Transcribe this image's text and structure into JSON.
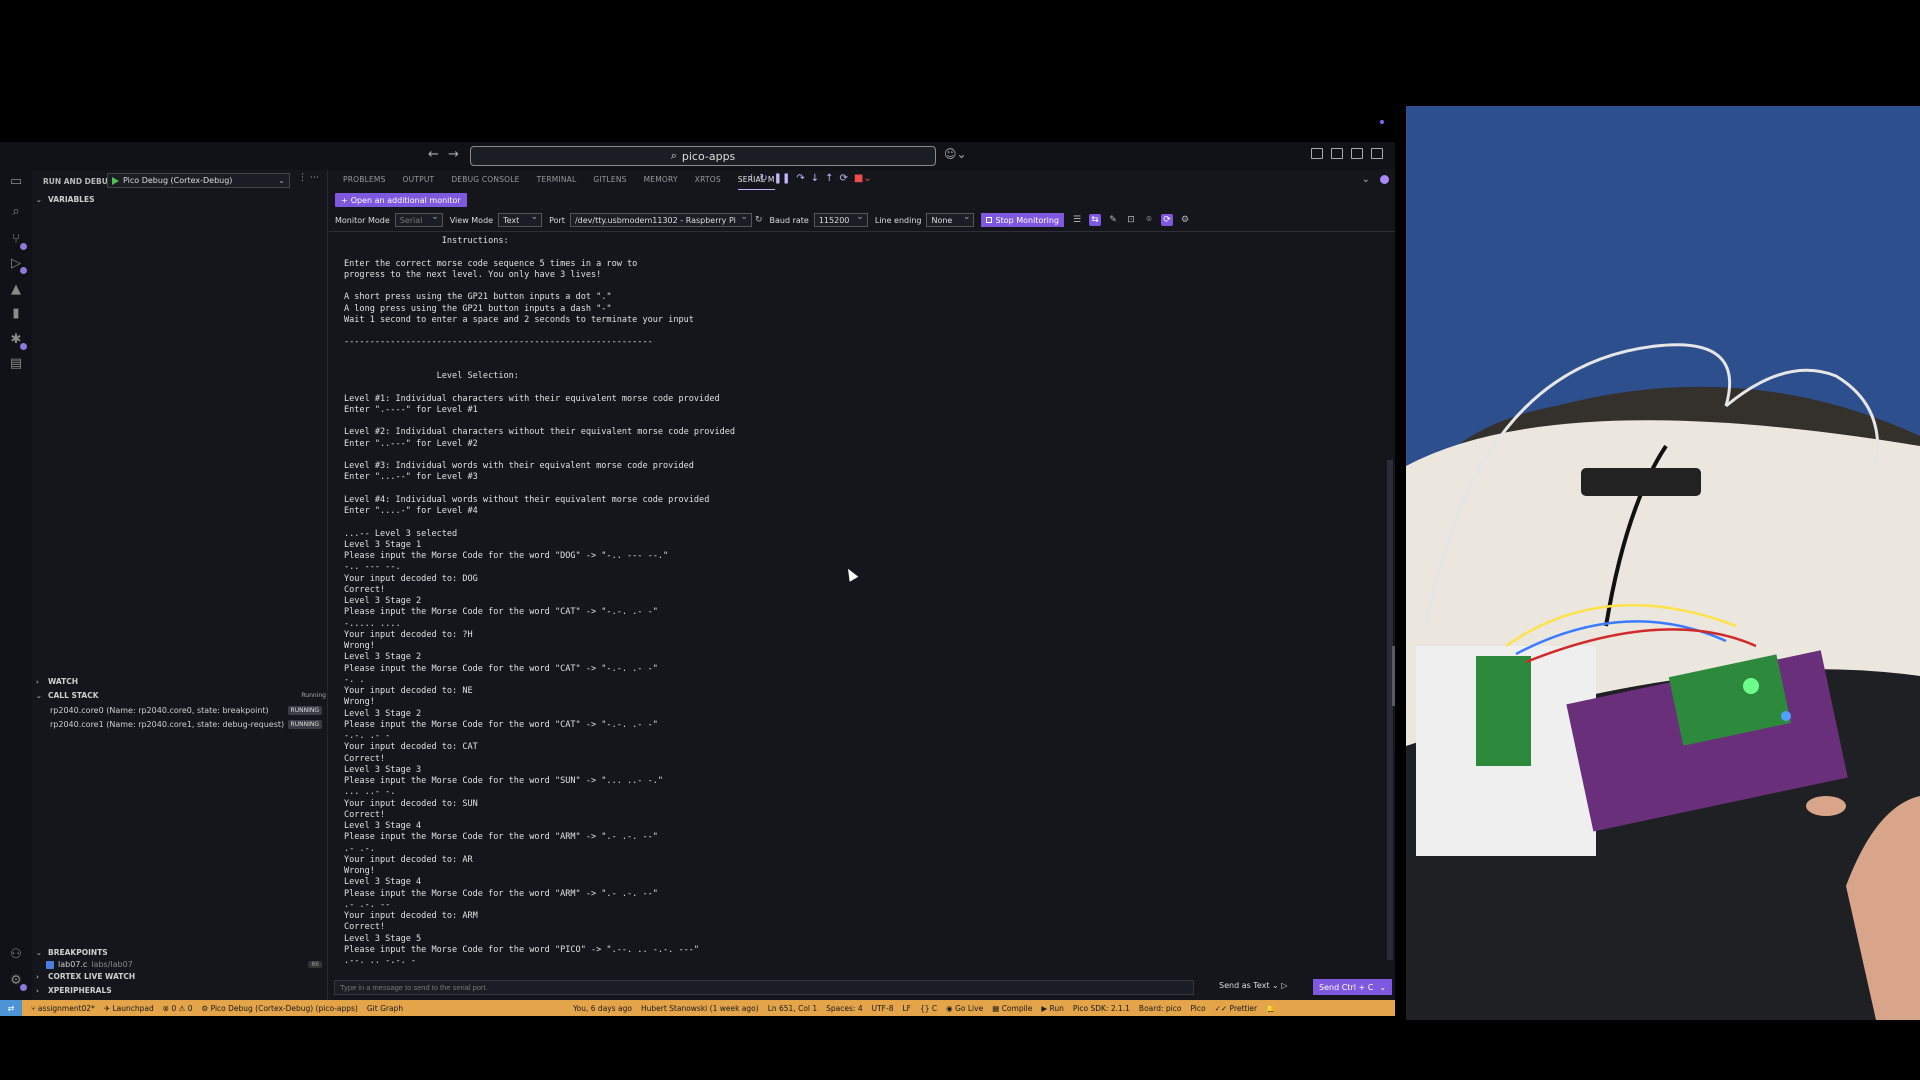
{
  "titlebar": {
    "search_text": "pico-apps",
    "copilot_icon": "copilot-icon"
  },
  "sidebar": {
    "run_label": "RUN AND DEBUG",
    "debug_config": "Pico Debug (Cortex-Debug)",
    "sections": {
      "variables": "VARIABLES",
      "watch": "WATCH",
      "call_stack": "CALL STACK",
      "call_stack_status": "Running",
      "breakpoints": "BREAKPOINTS",
      "cortex_live_watch": "CORTEX LIVE WATCH",
      "xperipherals": "XPERIPHERALS"
    },
    "call_stack_items": [
      {
        "name": "rp2040.core0 (Name: rp2040.core0, state: breakpoint)",
        "badge": "RUNNING"
      },
      {
        "name": "rp2040.core1 (Name: rp2040.core1, state: debug-request)",
        "badge": "RUNNING"
      }
    ],
    "breakpoint": {
      "file": "lab07.c",
      "path": "labs/lab07",
      "count": "86"
    }
  },
  "panel": {
    "tabs": [
      "PROBLEMS",
      "OUTPUT",
      "DEBUG CONSOLE",
      "TERMINAL",
      "GITLENS",
      "MEMORY",
      "XRTOS",
      "SERIAL M"
    ],
    "active_tab": "SERIAL M",
    "add_monitor_label": "Open an additional monitor",
    "monitor": {
      "monitor_mode_label": "Monitor Mode",
      "monitor_mode_value": "Serial",
      "view_mode_label": "View Mode",
      "view_mode_value": "Text",
      "port_label": "Port",
      "port_value": "/dev/tty.usbmodem11302 - Raspberry Pi",
      "baud_label": "Baud rate",
      "baud_value": "115200",
      "line_ending_label": "Line ending",
      "line_ending_value": "None",
      "stop_label": "Stop Monitoring"
    },
    "output_lines": [
      "                   Instructions:",
      "",
      "Enter the correct morse code sequence 5 times in a row to",
      "progress to the next level. You only have 3 lives!",
      "",
      "A short press using the GP21 button inputs a dot \".\"",
      "A long press using the GP21 button inputs a dash \"-\"",
      "Wait 1 second to enter a space and 2 seconds to terminate your input",
      "",
      "------------------------------------------------------------",
      "",
      "",
      "                  Level Selection:",
      "",
      "Level #1: Individual characters with their equivalent morse code provided",
      "Enter \".----\" for Level #1",
      "",
      "Level #2: Individual characters without their equivalent morse code provided",
      "Enter \"..---\" for Level #2",
      "",
      "Level #3: Individual words with their equivalent morse code provided",
      "Enter \"...--\" for Level #3",
      "",
      "Level #4: Individual words without their equivalent morse code provided",
      "Enter \"....-\" for Level #4",
      "",
      "...-- Level 3 selected",
      "Level 3 Stage 1",
      "Please input the Morse Code for the word \"DOG\" -> \"-.. --- --.\"",
      "-.. --- --.",
      "Your input decoded to: DOG",
      "Correct!",
      "Level 3 Stage 2",
      "Please input the Morse Code for the word \"CAT\" -> \"-.-. .- -\"",
      "-..... ....",
      "Your input decoded to: ?H",
      "Wrong!",
      "Level 3 Stage 2",
      "Please input the Morse Code for the word \"CAT\" -> \"-.-. .- -\"",
      "-. .",
      "Your input decoded to: NE",
      "Wrong!",
      "Level 3 Stage 2",
      "Please input the Morse Code for the word \"CAT\" -> \"-.-. .- -\"",
      "-.-. .- -",
      "Your input decoded to: CAT",
      "Correct!",
      "Level 3 Stage 3",
      "Please input the Morse Code for the word \"SUN\" -> \"... ..- -.\"",
      "... ..- -.",
      "Your input decoded to: SUN",
      "Correct!",
      "Level 3 Stage 4",
      "Please input the Morse Code for the word \"ARM\" -> \".- .-. --\"",
      ".- .-.",
      "Your input decoded to: AR",
      "Wrong!",
      "Level 3 Stage 4",
      "Please input the Morse Code for the word \"ARM\" -> \".- .-. --\"",
      ".- .-. --",
      "Your input decoded to: ARM",
      "Correct!",
      "Level 3 Stage 5",
      "Please input the Morse Code for the word \"PICO\" -> \".--. .. -.-. ---\"",
      ".--. .. -.-. -"
    ],
    "message_placeholder": "Type in a message to send to the serial port.",
    "send_as": "Send as Text",
    "send_ctrl": "Send Ctrl + C"
  },
  "statusbar": {
    "items": [
      "assignment02*",
      "Launchpad",
      "0 ⚠ 0",
      "Pico Debug (Cortex-Debug) (pico-apps)",
      "Git Graph",
      "You, 6 days ago",
      "Hubert Stanowski (1 week ago)",
      "Ln 651, Col 1",
      "Spaces: 4",
      "UTF-8",
      "LF",
      "{} C",
      "Go Live",
      "Compile",
      "Run",
      "Pico SDK: 2.1.1",
      "Board: pico",
      "Pico",
      "Prettier"
    ]
  },
  "colors": {
    "accent": "#7f58e0",
    "statusbar": "#e4a44a",
    "remote": "#4b94d6"
  }
}
